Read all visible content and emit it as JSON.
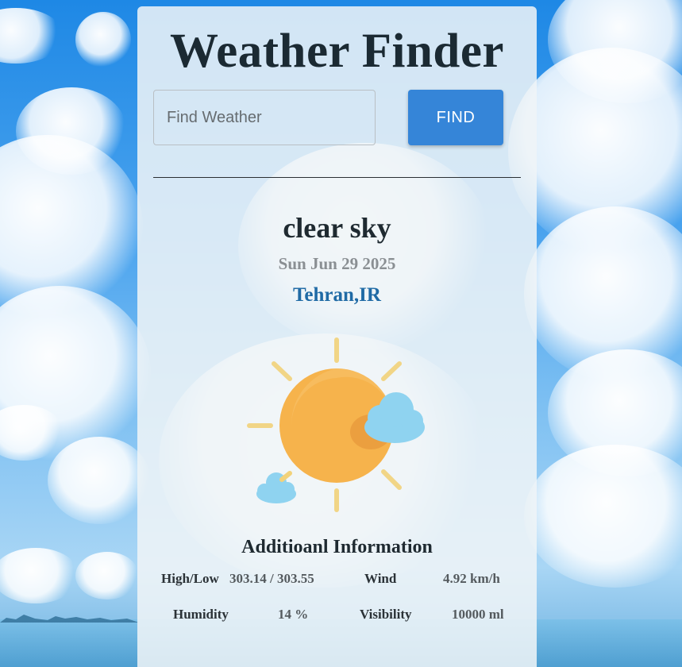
{
  "app": {
    "title": "Weather Finder"
  },
  "search": {
    "placeholder": "Find Weather",
    "value": "",
    "button_label": "FIND"
  },
  "current": {
    "condition": "clear sky",
    "date": "Sun Jun 29 2025",
    "location": "Tehran,IR",
    "icon": "sun-with-clouds-icon"
  },
  "additional_info": {
    "title": "Additioanl Information",
    "high_low_label": "High/Low",
    "high_low_value": "303.14  / 303.55",
    "wind_label": "Wind",
    "wind_value": "4.92 km/h",
    "humidity_label": "Humidity",
    "humidity_value": "14 %",
    "visibility_label": "Visibility",
    "visibility_value": "10000 ml"
  },
  "colors": {
    "find_button": "#3585d8",
    "location_text": "#1f6aa5",
    "sun": "#f6b34c",
    "cloud": "#8fd3f0"
  }
}
